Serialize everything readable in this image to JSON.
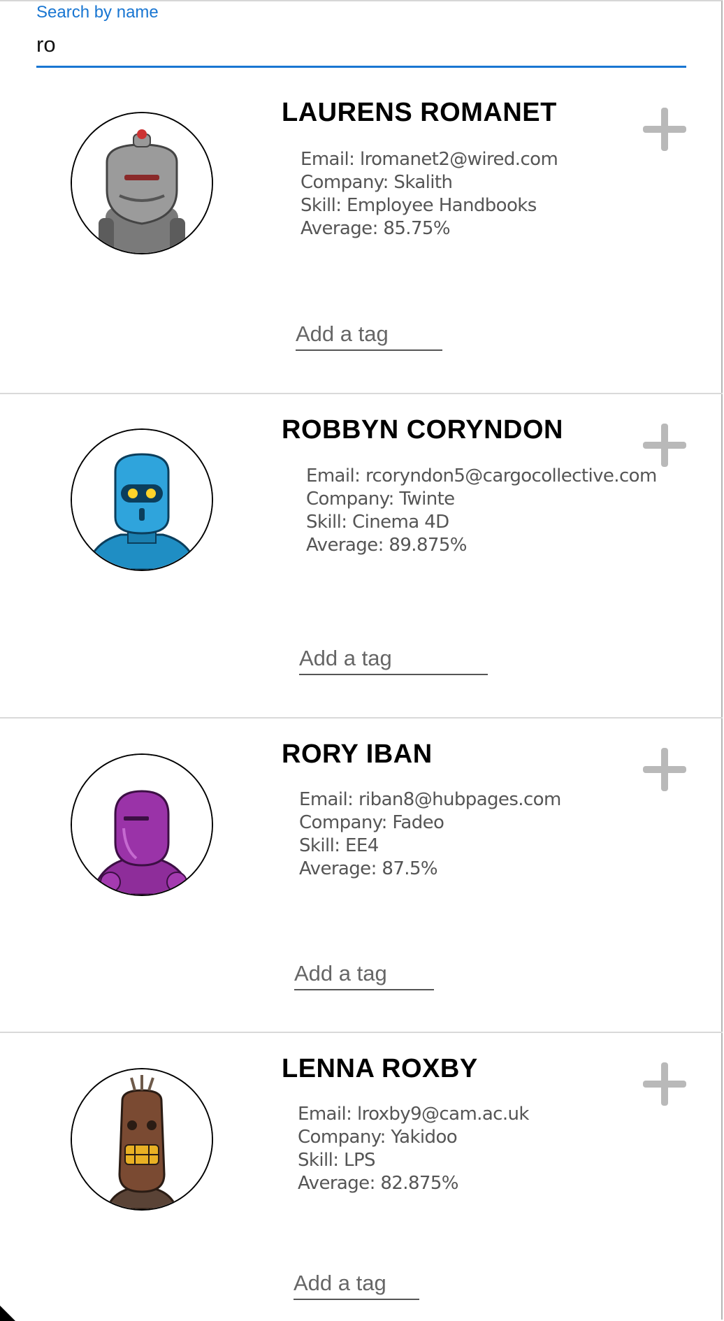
{
  "search": {
    "label": "Search by name",
    "value": "ro"
  },
  "students": [
    {
      "name": "LAURENS ROMANET",
      "email": "Email: lromanet2@wired.com",
      "company": "Company: Skalith",
      "skill": "Skill: Employee Handbooks",
      "average": "Average: 85.75%",
      "tag_placeholder": "Add a tag",
      "avatar": "gray-robot-avatar"
    },
    {
      "name": "ROBBYN CORYNDON",
      "email": "Email: rcoryndon5@cargocollective.com",
      "company": "Company: Twinte",
      "skill": "Skill: Cinema 4D",
      "average": "Average: 89.875%",
      "tag_placeholder": "Add a tag",
      "avatar": "blue-robot-avatar"
    },
    {
      "name": "RORY IBAN",
      "email": "Email: riban8@hubpages.com",
      "company": "Company: Fadeo",
      "skill": "Skill: EE4",
      "average": "Average: 87.5%",
      "tag_placeholder": "Add a tag",
      "avatar": "purple-robot-avatar"
    },
    {
      "name": "LENNA ROXBY",
      "email": "Email: lroxby9@cam.ac.uk",
      "company": "Company: Yakidoo",
      "skill": "Skill: LPS",
      "average": "Average: 82.875%",
      "tag_placeholder": "Add a tag",
      "avatar": "brown-robot-avatar"
    }
  ],
  "icons": {
    "expand": "plus-icon"
  },
  "colors": {
    "accent": "#1976d2",
    "plus_icon": "#b9b9b9"
  }
}
